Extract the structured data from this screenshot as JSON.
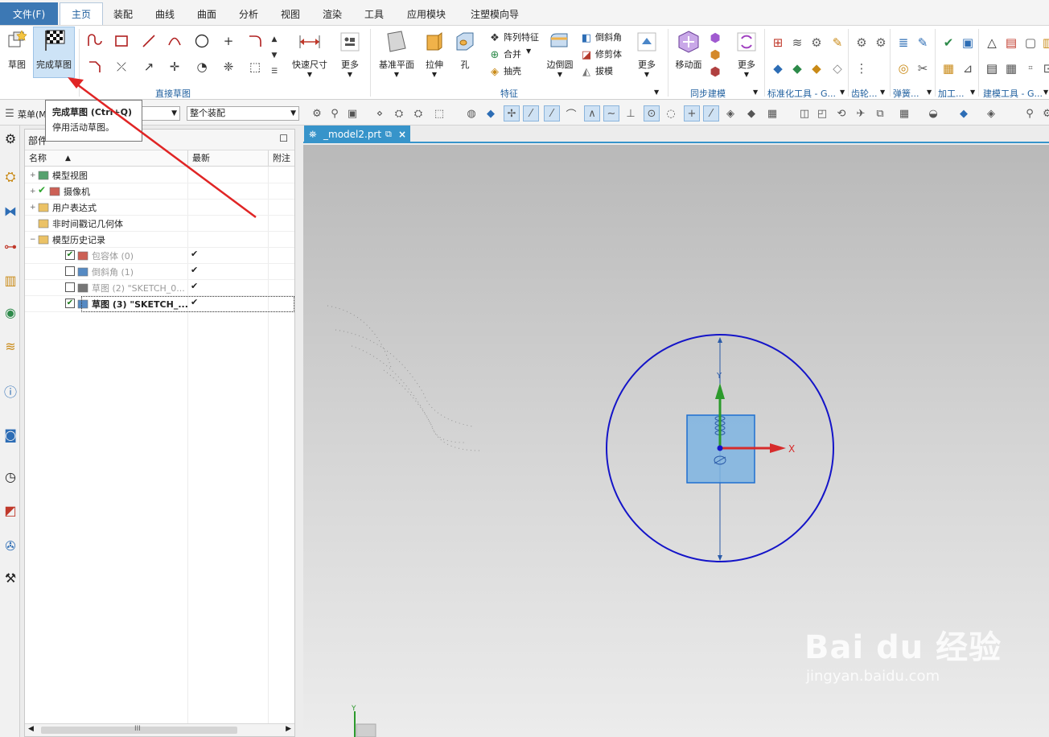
{
  "menubar": {
    "file": "文件(F)",
    "tabs": [
      {
        "label": "主页",
        "active": true
      },
      {
        "label": "装配"
      },
      {
        "label": "曲线"
      },
      {
        "label": "曲面"
      },
      {
        "label": "分析"
      },
      {
        "label": "视图"
      },
      {
        "label": "渲染"
      },
      {
        "label": "工具"
      },
      {
        "label": "应用模块"
      },
      {
        "label": "注塑模向导"
      }
    ]
  },
  "ribbon": {
    "sketch": "草图",
    "finish_sketch": "完成草图",
    "quick_dimension": "快速尺寸",
    "more": "更多",
    "datum_plane": "基准平面",
    "extrude": "拉伸",
    "hole": "孔",
    "pattern_feature": "阵列特征",
    "unite": "合并",
    "shell": "抽壳",
    "edge_blend": "边倒圆",
    "chamfer": "倒斜角",
    "trim_body": "修剪体",
    "draft": "拔模",
    "move_face": "移动面",
    "groups": {
      "direct_sketch": "直接草图",
      "feature": "特征",
      "sync_modeling": "同步建模",
      "std_tools": "标准化工具 - G...",
      "gear": "齿轮...",
      "spring": "弹簧...",
      "machining": "加工...",
      "modeling_tools": "建模工具 - G..."
    }
  },
  "toolbar2": {
    "menu_label": "菜单(M)",
    "filter_value": "",
    "assembly_scope": "整个装配"
  },
  "tooltip": {
    "title": "完成草图 (Ctrl+Q)",
    "description": "停用活动草图。"
  },
  "part_navigator": {
    "title": "部件",
    "columns": [
      "名称",
      "最新",
      "附注"
    ],
    "rows": [
      {
        "label": "模型视图",
        "latest": false
      },
      {
        "label": "摄像机",
        "latest": false
      },
      {
        "label": "用户表达式",
        "latest": false
      },
      {
        "label": "非时间戳记几何体",
        "latest": false
      },
      {
        "label": "模型历史记录",
        "latest": false
      },
      {
        "label": "包容体 (0)",
        "latest": true
      },
      {
        "label": "倒斜角 (1)",
        "latest": true
      },
      {
        "label": "草图 (2) \"SKETCH_0...",
        "latest": true
      },
      {
        "label": "草图 (3) \"SKETCH_...",
        "latest": true
      }
    ],
    "scroll_mark": "III"
  },
  "document_tab": {
    "label": "_model2.prt",
    "close": "×"
  },
  "viewport": {
    "axis_x": "X",
    "axis_y": "Y",
    "axis_y_bottom": "Y",
    "colors": {
      "circle": "#1414c8",
      "square_fill": "#7eb4e2",
      "x_axis": "#d62b2b",
      "y_axis": "#2c9a2c"
    }
  },
  "watermark": {
    "brand": "Bai du 经验",
    "url": "jingyan.baidu.com"
  }
}
